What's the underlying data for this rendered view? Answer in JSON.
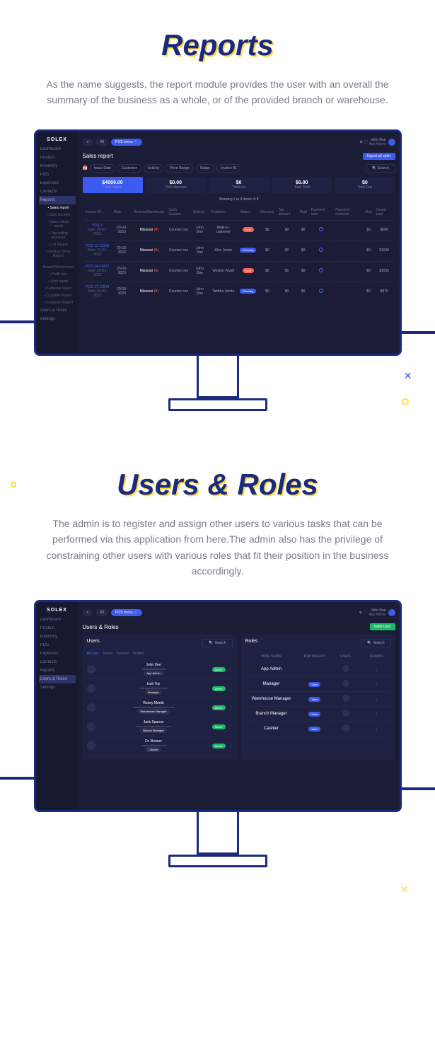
{
  "section1": {
    "title": "Reports",
    "desc": "As the name suggests, the report module provides the user with an overall the summary of the business as a whole, or of the provided branch or warehouse."
  },
  "section2": {
    "title": "Users & Roles",
    "desc": "The admin is to register and assign other users to various tasks that can be performed via this application from here.The admin also has the privilege of constraining other users with various roles that fit their position in the business accordingly."
  },
  "common": {
    "logo": "SOLEX",
    "all": "All",
    "pos_menu": "POS menu",
    "user_name": "John Doe",
    "user_role": "App Admin",
    "search": "Search"
  },
  "nav": {
    "dashboard": "Dashboard",
    "product": "Product",
    "inventory": "Inventory",
    "pos": "POS",
    "expenses": "Expenses",
    "contacts": "Contacts",
    "reports": "Reports",
    "users_roles": "Users & Roles",
    "settings": "Settings"
  },
  "reports_subs": [
    "Sales report",
    "Cash Counter",
    "Sales return report",
    "Top selling products",
    "Lot Report",
    "Product Stock Report",
    "Branch/Warehouse",
    "Profit loss",
    "User report",
    "Expense report",
    "Supplier Report",
    "Customer Report"
  ],
  "reports_page": {
    "title": "Sales report",
    "export": "Export all order",
    "filters": [
      "Issue Date",
      "Customer",
      "Sold by",
      "Price Range",
      "Status",
      "Invoice ID"
    ],
    "stats": [
      {
        "val": "$4000.00",
        "lbl": "Total Sales"
      },
      {
        "val": "$0.00",
        "lbl": "Total discount"
      },
      {
        "val": "$0",
        "lbl": "Total tax"
      },
      {
        "val": "$0.00",
        "lbl": "Total Paid"
      },
      {
        "val": "$0",
        "lbl": "Total Due"
      }
    ],
    "showing": "Showing 1 to 8 items of 8",
    "headers": [
      "Invoice ID",
      "Date",
      "Branch/Warehouse",
      "Cash Counter",
      "Sold by",
      "Customer",
      "Status",
      "Discount",
      "Tax amount",
      "Paid",
      "Payment note",
      "Payment methods",
      "Due",
      "Grand total"
    ],
    "rows": [
      {
        "id": "POS-1",
        "idsub": "Date: 20-03-2023",
        "date": "20-03-2023",
        "branch": "Missouri",
        "branchflag": "(B)",
        "counter": "Counter one",
        "soldby": "John Doe",
        "customer": "Walk-in-customer",
        "status": "Hold",
        "statusClass": "hold",
        "discount": "$0",
        "tax": "$0",
        "paid": "$0",
        "due": "$0",
        "total": "$500"
      },
      {
        "id": "POS-12-12369",
        "idsub": "Date: 20-03-2023",
        "date": "20-03-2023",
        "branch": "Missouri",
        "branchflag": "(B)",
        "counter": "Counter one",
        "soldby": "John Doe",
        "customer": "Alex Jones",
        "status": "Pending",
        "statusClass": "pending",
        "discount": "$0",
        "tax": "$0",
        "paid": "$0",
        "due": "$0",
        "total": "$1000"
      },
      {
        "id": "POS-14-13412",
        "idsub": "Date: 20-03-2023",
        "date": "20-03-2023",
        "branch": "Missouri",
        "branchflag": "(B)",
        "counter": "Counter one",
        "soldby": "John Doe",
        "customer": "Weston Wyatt",
        "status": "Hold",
        "statusClass": "hold",
        "discount": "$0",
        "tax": "$0",
        "paid": "$0",
        "due": "$0",
        "total": "$1050"
      },
      {
        "id": "POS-17-13594",
        "idsub": "Date: 20-03-2023",
        "date": "20-03-2023",
        "branch": "Missouri",
        "branchflag": "(B)",
        "counter": "Counter one",
        "soldby": "John Doe",
        "customer": "Tabitha Jenda",
        "status": "Pending",
        "statusClass": "pending",
        "discount": "$0",
        "tax": "$0",
        "paid": "$0",
        "due": "$0",
        "total": "$970"
      }
    ]
  },
  "users_page": {
    "title": "Users & Roles",
    "invite": "Invite User",
    "users_title": "Users",
    "roles_title": "Roles",
    "tabs": [
      "All user",
      "Active",
      "Inactive",
      "Invited"
    ],
    "role_headers": [
      "Role name",
      "Permission",
      "Users",
      "Actions"
    ],
    "users": [
      {
        "name": "John Doe",
        "email": "admin@demo.com",
        "role": "App Admin",
        "status": "Active"
      },
      {
        "name": "Ivah Toy",
        "email": "manager@demo.com",
        "role": "Manager",
        "status": "Active"
      },
      {
        "name": "Rosey Month",
        "email": "warehousemanager@demo.com",
        "role": "Warehouse Manager",
        "status": "Active"
      },
      {
        "name": "Jack Sparow",
        "email": "branchmanager@demo.com",
        "role": "Branch Manager",
        "status": "Active"
      },
      {
        "name": "Dr. Bonner",
        "email": "cashier@demo.com",
        "role": "Cashier",
        "status": "Active"
      }
    ],
    "roles": [
      {
        "name": "App Admin",
        "perm": "",
        "users": "JD"
      },
      {
        "name": "Manager",
        "perm": "View",
        "users": "IT"
      },
      {
        "name": "Warehouse Manager",
        "perm": "View",
        "users": "RM"
      },
      {
        "name": "Branch Manager",
        "perm": "View",
        "users": "JS"
      },
      {
        "name": "Cashier",
        "perm": "View",
        "users": "DB"
      }
    ]
  }
}
